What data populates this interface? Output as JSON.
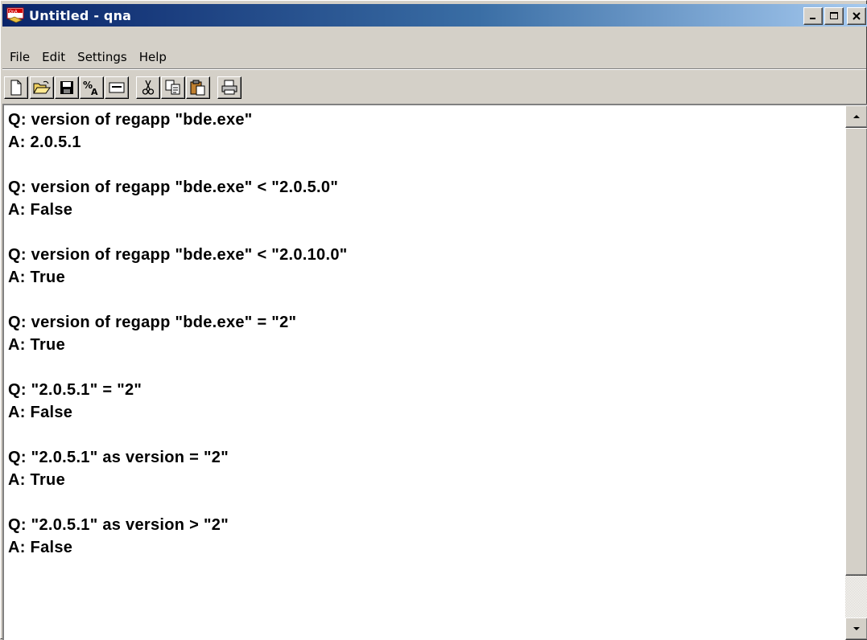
{
  "window": {
    "title": "Untitled - qna",
    "app_icon": "qna-app-icon",
    "controls": [
      "minimize-icon",
      "maximize-icon",
      "close-icon"
    ]
  },
  "menu": {
    "items": [
      "File",
      "Edit",
      "Settings",
      "Help"
    ]
  },
  "toolbar": {
    "buttons": [
      "new-document-icon",
      "open-folder-icon",
      "save-disk-icon",
      "percent-evaluate-icon",
      "window-icon",
      "cut-scissors-icon",
      "copy-icon",
      "paste-clipboard-icon",
      "print-icon"
    ]
  },
  "editor": {
    "lines": [
      "Q: version of regapp \"bde.exe\"",
      "A: 2.0.5.1",
      "",
      "Q: version of regapp \"bde.exe\" < \"2.0.5.0\"",
      "A: False",
      "",
      "Q: version of regapp \"bde.exe\" < \"2.0.10.0\"",
      "A: True",
      "",
      "Q: version of regapp \"bde.exe\" = \"2\"",
      "A: True",
      "",
      "Q: \"2.0.5.1\" = \"2\"",
      "A: False",
      "",
      "Q: \"2.0.5.1\" as version = \"2\"",
      "A: True",
      "",
      "Q: \"2.0.5.1\" as version > \"2\"",
      "A: False"
    ]
  },
  "colors": {
    "titlebar_start": "#0a246a",
    "titlebar_end": "#a6caf0",
    "chrome": "#d4d0c8",
    "editor_bg": "#ffffff"
  }
}
